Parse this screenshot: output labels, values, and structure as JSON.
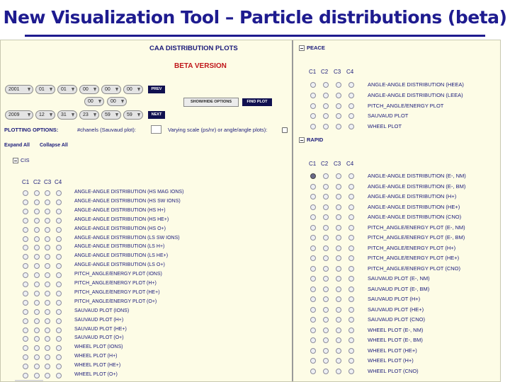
{
  "slide_title": "New Visualization Tool – Particle distributions (beta)",
  "left": {
    "header": "CAA DISTRIBUTION PLOTS",
    "subheader": "BETA VERSION",
    "start": [
      "2001",
      "01",
      "01",
      "00",
      "00",
      "00"
    ],
    "mid": [
      "00",
      "00"
    ],
    "end": [
      "2009",
      "12",
      "31",
      "23",
      "59",
      "59"
    ],
    "prev_label": "PREV",
    "next_label": "NEXT",
    "show_hide_label": "SHOW/HIDE OPTIONS",
    "find_plot_label": "FIND PLOT",
    "plotting_options_label": "PLOTTING OPTIONS:",
    "channels_label": "#chanels (Sauvaud plot):",
    "varying_scale_label": "Varying scale (ps/nr) or angle/angle plots):",
    "expand_all": "Expand All",
    "collapse_all": "Collapse All",
    "cis_label": "CIS",
    "columns": [
      "C1",
      "C2",
      "C3",
      "C4"
    ],
    "cis_options": [
      "ANGLE-ANGLE DISTRIBUTION (HS MAG IONS)",
      "ANGLE-ANGLE DISTRIBUTION (HS SW IONS)",
      "ANGLE-ANGLE DISTRIBUTION (HS H+)",
      "ANGLE-ANGLE DISTRIBUTION (HS He+)",
      "ANGLE-ANGLE DISTRIBUTION (HS O+)",
      "ANGLE-ANGLE DISTRIBUTION (LS SW IONS)",
      "ANGLE-ANGLE DISTRIBUTION (LS H+)",
      "ANGLE-ANGLE DISTRIBUTION (LS He+)",
      "ANGLE-ANGLE DISTRIBUTION (LS O+)",
      "PITCH_ANGLE/ENERGY PLOT (IONS)",
      "PITCH_ANGLE/ENERGY PLOT (H+)",
      "PITCH_ANGLE/ENERGY PLOT (He+)",
      "PITCH_ANGLE/ENERGY PLOT (O+)",
      "SAUVAUD PLOT (IONS)",
      "SAUVAUD PLOT (H+)",
      "SAUVAUD PLOT (He+)",
      "SAUVAUD PLOT (O+)",
      "WHEEL PLOT (IONS)",
      "WHEEL PLOT (H+)",
      "WHEEL PLOT (He+)",
      "WHEEL PLOT (O+)"
    ]
  },
  "right": {
    "peace_label": "PEACE",
    "rapid_label": "RAPID",
    "columns": [
      "C1",
      "C2",
      "C3",
      "C4"
    ],
    "peace_options": [
      "ANGLE-ANGLE DISTRIBUTION (HEEA)",
      "ANGLE-ANGLE DISTRIBUTION (LEEA)",
      "PITCH_ANGLE/ENERGY PLOT",
      "SAUVAUD PLOT",
      "WHEEL PLOT"
    ],
    "rapid_options": [
      "ANGLE-ANGLE DISTRIBUTION (e-, NM)",
      "ANGLE-ANGLE DISTRIBUTION (e-, BM)",
      "ANGLE-ANGLE DISTRIBUTION (H+)",
      "ANGLE-ANGLE DISTRIBUTION (He+)",
      "ANGLE-ANGLE DISTRIBUTION (CNO)",
      "PITCH_ANGLE/ENERGY PLOT (e-, NM)",
      "PITCH_ANGLE/ENERGY PLOT (e-, BM)",
      "PITCH_ANGLE/ENERGY PLOT (H+)",
      "PITCH_ANGLE/ENERGY PLOT (He+)",
      "PITCH_ANGLE/ENERGY PLOT (CNO)",
      "SAUVAUD PLOT (e-, NM)",
      "SAUVAUD PLOT (e-, BM)",
      "SAUVAUD PLOT (H+)",
      "SAUVAUD PLOT (He+)",
      "SAUVAUD PLOT (CNO)",
      "WHEEL PLOT (e-, NM)",
      "WHEEL PLOT (e-, BM)",
      "WHEEL PLOT (He+)",
      "WHEEL PLOT (H+)",
      "WHEEL PLOT (CNO)"
    ],
    "rapid_selected": {
      "row": 0,
      "col": 0
    }
  },
  "colors": {
    "title": "#1e1b8f",
    "panel_bg": "#fdfce6",
    "beta": "#c0161a",
    "button_dark": "#101050"
  }
}
